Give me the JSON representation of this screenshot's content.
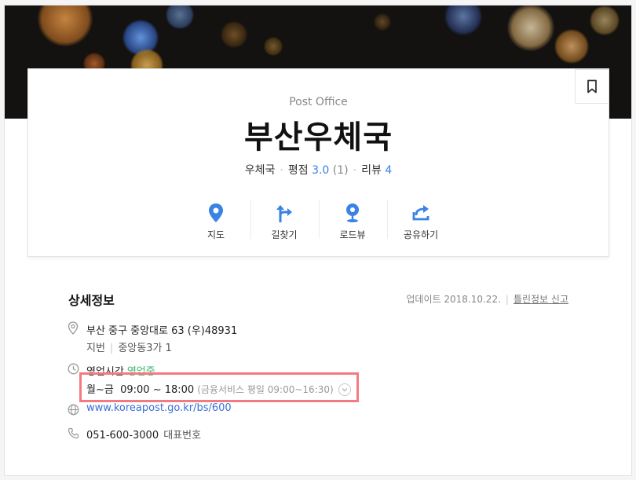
{
  "place": {
    "category_en": "Post Office",
    "name": "부산우체국",
    "category_ko": "우체국",
    "rating_label": "평점",
    "rating_value": "3.0",
    "rating_count": "(1)",
    "review_label": "리뷰",
    "review_count": "4"
  },
  "actions": [
    {
      "label": "지도",
      "icon": "map-pin-icon"
    },
    {
      "label": "길찾기",
      "icon": "directions-icon"
    },
    {
      "label": "로드뷰",
      "icon": "roadview-icon"
    },
    {
      "label": "공유하기",
      "icon": "share-icon"
    }
  ],
  "detail": {
    "title": "상세정보",
    "updated": "업데이트 2018.10.22.",
    "report_link": "틀린정보 신고",
    "address": "부산 중구 중앙대로 63 (우)48931",
    "jibun_label": "지번",
    "jibun_value": "중앙동3가 1",
    "hours_label": "영업시간",
    "hours_status": "영업중",
    "hours_days": "월~금",
    "hours_time": "09:00 ~ 18:00",
    "hours_note": "(금융서비스 평일 09:00~16:30)",
    "website": "www.koreapost.go.kr/bs/600",
    "phone": "051-600-3000",
    "phone_tag": "대표번호"
  },
  "colors": {
    "accent_blue": "#3a82e4",
    "open_green": "#3bb26c",
    "highlight_red": "#f37a7f"
  }
}
